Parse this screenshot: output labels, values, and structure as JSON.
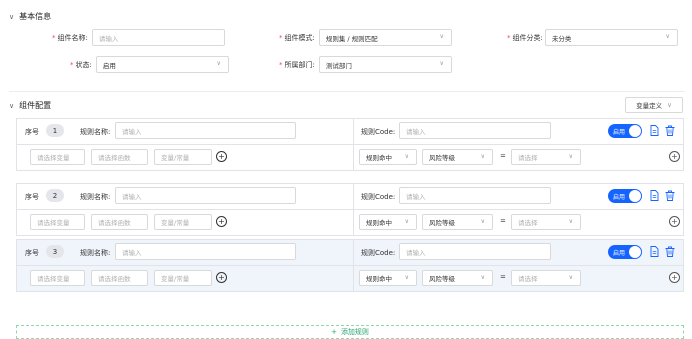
{
  "section_basic": {
    "title": "基本信息"
  },
  "form": {
    "name_label": "组件名称:",
    "name_placeholder": "请输入",
    "mode_label": "组件模式:",
    "mode_value": "规则集 / 规则匹配",
    "category_label": "组件分类:",
    "category_value": "未分类",
    "status_label": "状态:",
    "status_value": "启用",
    "dept_label": "所属部门:",
    "dept_value": "测试部门"
  },
  "section_config": {
    "title": "组件配置",
    "var_button": "变量定义"
  },
  "rules": [
    {
      "seq": "序号",
      "index": "1",
      "rule_name_label": "规则名称:",
      "rule_name_placeholder": "请输入",
      "rule_code_label": "规则Code:",
      "rule_code_placeholder": "请输入",
      "toggle_label": "启用",
      "var_placeholder": "请选择变量",
      "func_placeholder": "请选择函数",
      "const_placeholder": "变量/常量",
      "hit_value": "规则命中",
      "risk_value": "风险等级",
      "eq": "=",
      "select_placeholder": "请选择"
    },
    {
      "seq": "序号",
      "index": "2",
      "rule_name_label": "规则名称:",
      "rule_name_placeholder": "请输入",
      "rule_code_label": "规则Code:",
      "rule_code_placeholder": "请输入",
      "toggle_label": "启用",
      "var_placeholder": "请选择变量",
      "func_placeholder": "请选择函数",
      "const_placeholder": "变量/常量",
      "hit_value": "规则命中",
      "risk_value": "风险等级",
      "eq": "=",
      "select_placeholder": "请选择"
    },
    {
      "seq": "序号",
      "index": "3",
      "rule_name_label": "规则名称:",
      "rule_name_placeholder": "请输入",
      "rule_code_label": "规则Code:",
      "rule_code_placeholder": "请输入",
      "toggle_label": "启用",
      "var_placeholder": "请选择变量",
      "func_placeholder": "请选择函数",
      "const_placeholder": "变量/常量",
      "hit_value": "规则命中",
      "risk_value": "风险等级",
      "eq": "=",
      "select_placeholder": "请选择"
    }
  ],
  "add_rule": {
    "label": "添加规则"
  },
  "colors": {
    "primary": "#1664ff",
    "required": "#e34d59",
    "add": "#2ba471",
    "highlight": "#f0f4fb"
  }
}
